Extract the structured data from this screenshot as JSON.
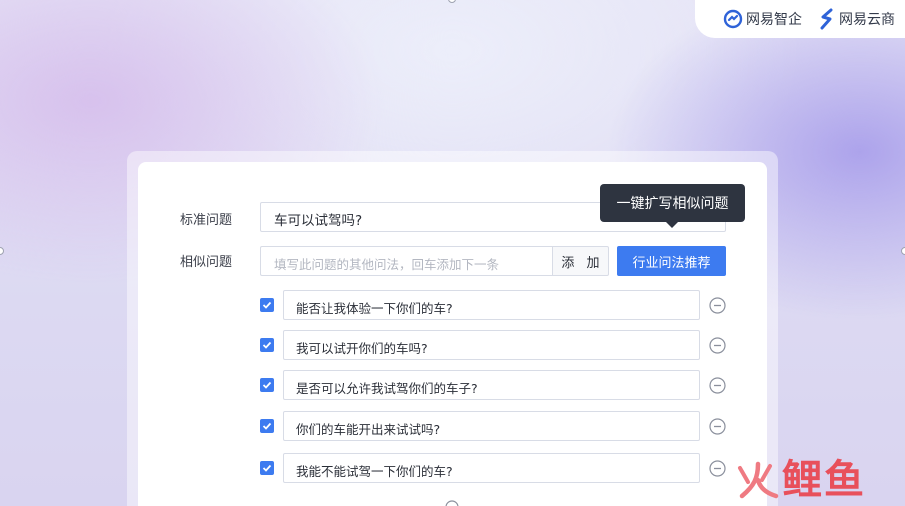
{
  "brands": [
    {
      "name": "网易智企",
      "icon": "netease-zhiqi-logo-icon"
    },
    {
      "name": "网易云商",
      "icon": "netease-yunshang-logo-icon"
    }
  ],
  "form": {
    "standard_label": "标准问题",
    "standard_value": "车可以试驾吗?",
    "similar_label": "相似问题",
    "similar_placeholder": "填写此问题的其他问法，回车添加下一条",
    "add_label": "添 加",
    "recommend_label": "行业问法推荐",
    "tooltip": "一键扩写相似问题"
  },
  "questions": [
    {
      "text": "能否让我体验一下你们的车?",
      "checked": true
    },
    {
      "text": "我可以试开你们的车吗?",
      "checked": true
    },
    {
      "text": "是否可以允许我试驾你们的车子?",
      "checked": true
    },
    {
      "text": "你们的车能开出来试试吗?",
      "checked": true
    },
    {
      "text": "我能不能试驾一下你们的车?",
      "checked": true
    }
  ],
  "colors": {
    "accent": "#3d7bf0",
    "tooltip_bg": "#2e3440",
    "watermark_red": "#e8505b"
  },
  "watermark": {
    "text": "鲤鱼",
    "icon": "fire-mark-icon"
  }
}
